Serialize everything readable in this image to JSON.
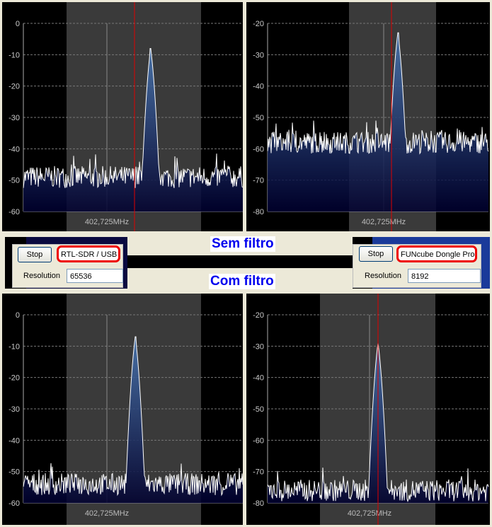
{
  "captions": {
    "top": "Sem filtro",
    "bottom": "Com filtro"
  },
  "left_device": {
    "stop_label": "Stop",
    "device": "RTL-SDR / USB",
    "resolution_label": "Resolution",
    "resolution": "65536"
  },
  "right_device": {
    "stop_label": "Stop",
    "device": "FUNcube Dongle Pro",
    "resolution_label": "Resolution",
    "resolution": "8192"
  },
  "colors": {
    "trace": "#ffffff",
    "fill": "#1e3c78",
    "center_line": "#e00000",
    "band": "#3a3a3a"
  },
  "chart_data": [
    {
      "type": "line",
      "name": "RTL-SDR sem filtro",
      "xlabel": "402,725MHz",
      "ylim": [
        -60,
        0
      ],
      "yticks": [
        "0",
        "-10",
        "-20",
        "-30",
        "-40",
        "-50",
        "-60"
      ],
      "noise_floor": -49,
      "peak": -8,
      "peak_pos": 0.58,
      "grid": true
    },
    {
      "type": "line",
      "name": "FUNcube sem filtro",
      "xlabel": "402,725MHz",
      "ylim": [
        -80,
        -20
      ],
      "yticks": [
        "-20",
        "-30",
        "-40",
        "-50",
        "-60",
        "-70",
        "-80"
      ],
      "noise_floor": -58,
      "peak": -23,
      "peak_pos": 0.59,
      "grid": true
    },
    {
      "type": "line",
      "name": "RTL-SDR com filtro",
      "xlabel": "402,725MHz",
      "ylim": [
        -60,
        0
      ],
      "yticks": [
        "0",
        "-10",
        "-20",
        "-30",
        "-40",
        "-50",
        "-60"
      ],
      "noise_floor": -54,
      "peak": -7,
      "peak_pos": 0.51,
      "grid": true
    },
    {
      "type": "line",
      "name": "FUNcube com filtro",
      "xlabel": "402,725MHz",
      "ylim": [
        -80,
        -20
      ],
      "yticks": [
        "-20",
        "-30",
        "-40",
        "-50",
        "-60",
        "-70",
        "-80"
      ],
      "noise_floor": -76,
      "peak": -29,
      "peak_pos": 0.5,
      "grid": true
    }
  ]
}
